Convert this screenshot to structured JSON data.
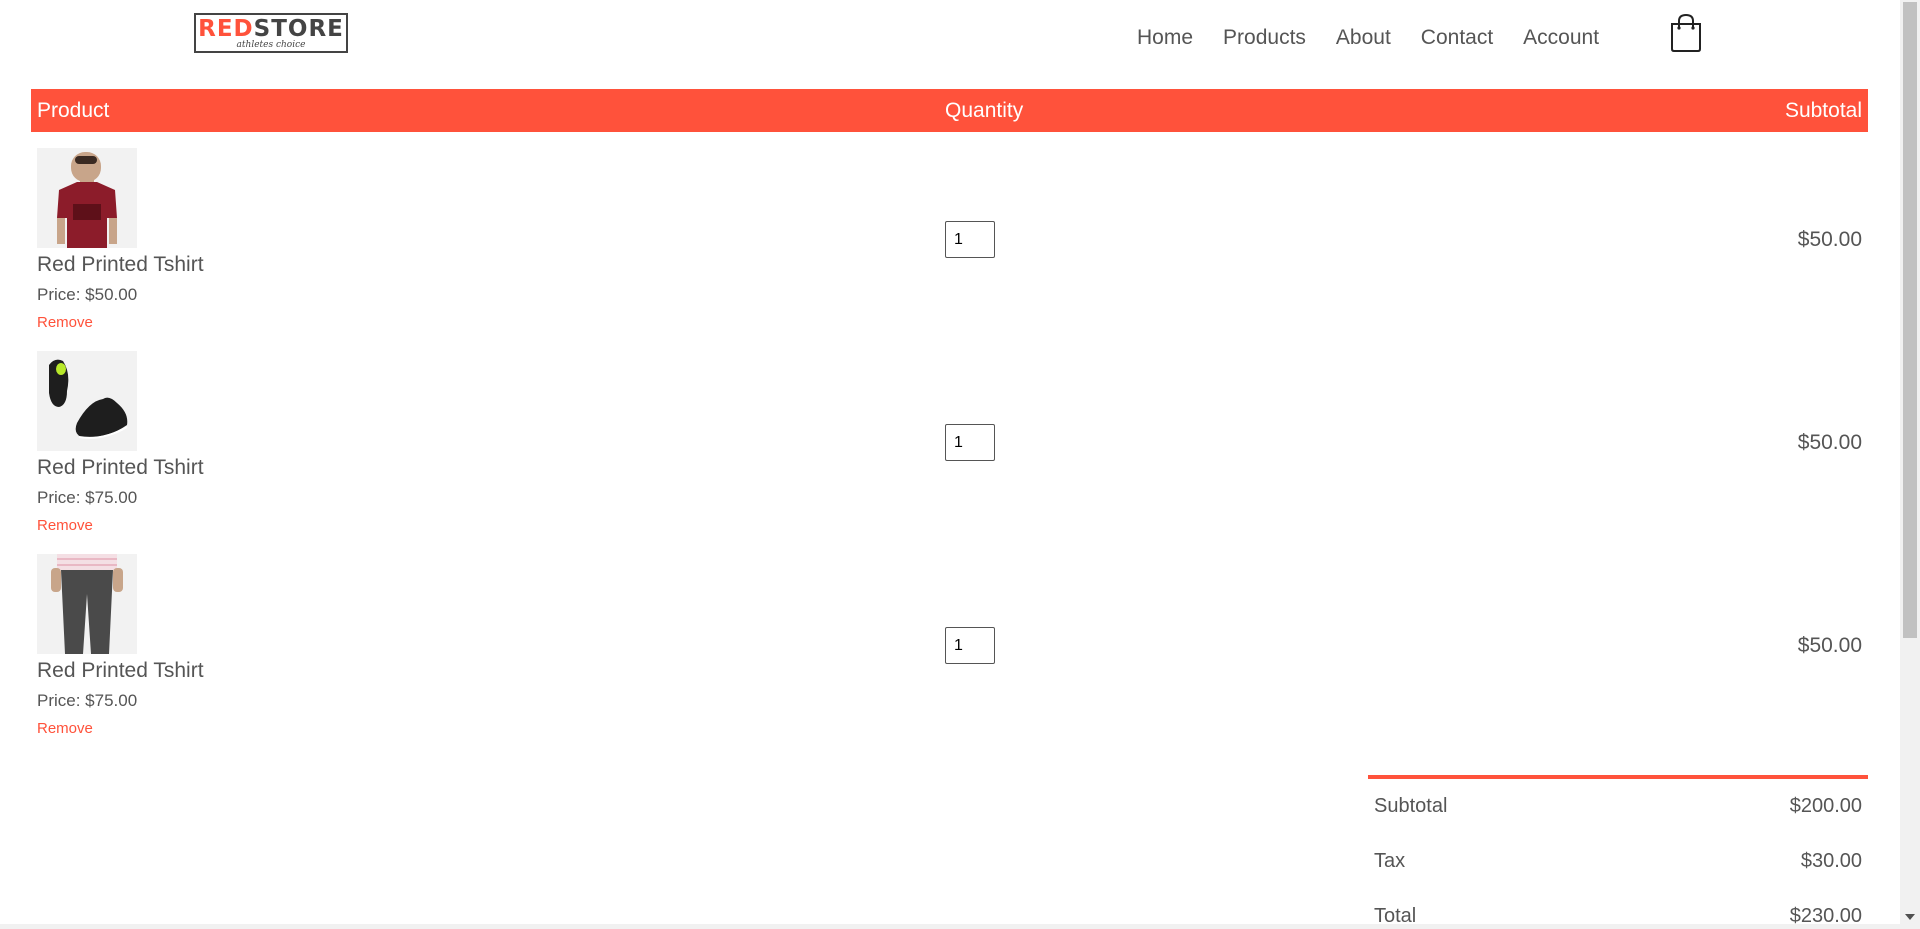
{
  "brand": {
    "logo_main_red": "RED",
    "logo_main_dark": "STORE",
    "logo_tagline": "athletes choice",
    "accent_color": "#ff523b"
  },
  "nav": {
    "items": [
      {
        "label": "Home"
      },
      {
        "label": "Products"
      },
      {
        "label": "About"
      },
      {
        "label": "Contact"
      },
      {
        "label": "Account"
      }
    ],
    "cart_icon": "shopping-bag-icon"
  },
  "table": {
    "headers": {
      "product": "Product",
      "quantity": "Quantity",
      "subtotal": "Subtotal"
    },
    "rows": [
      {
        "image": "red-tshirt-image",
        "name": "Red Printed Tshirt",
        "price": "Price: $50.00",
        "remove_label": "Remove",
        "quantity": "1",
        "subtotal": "$50.00"
      },
      {
        "image": "black-shoes-image",
        "name": "Red Printed Tshirt",
        "price": "Price: $75.00",
        "remove_label": "Remove",
        "quantity": "1",
        "subtotal": "$50.00"
      },
      {
        "image": "grey-joggers-image",
        "name": "Red Printed Tshirt",
        "price": "Price: $75.00",
        "remove_label": "Remove",
        "quantity": "1",
        "subtotal": "$50.00"
      }
    ]
  },
  "totals": {
    "subtotal_label": "Subtotal",
    "subtotal_value": "$200.00",
    "tax_label": "Tax",
    "tax_value": "$30.00",
    "total_label": "Total",
    "total_value": "$230.00"
  }
}
